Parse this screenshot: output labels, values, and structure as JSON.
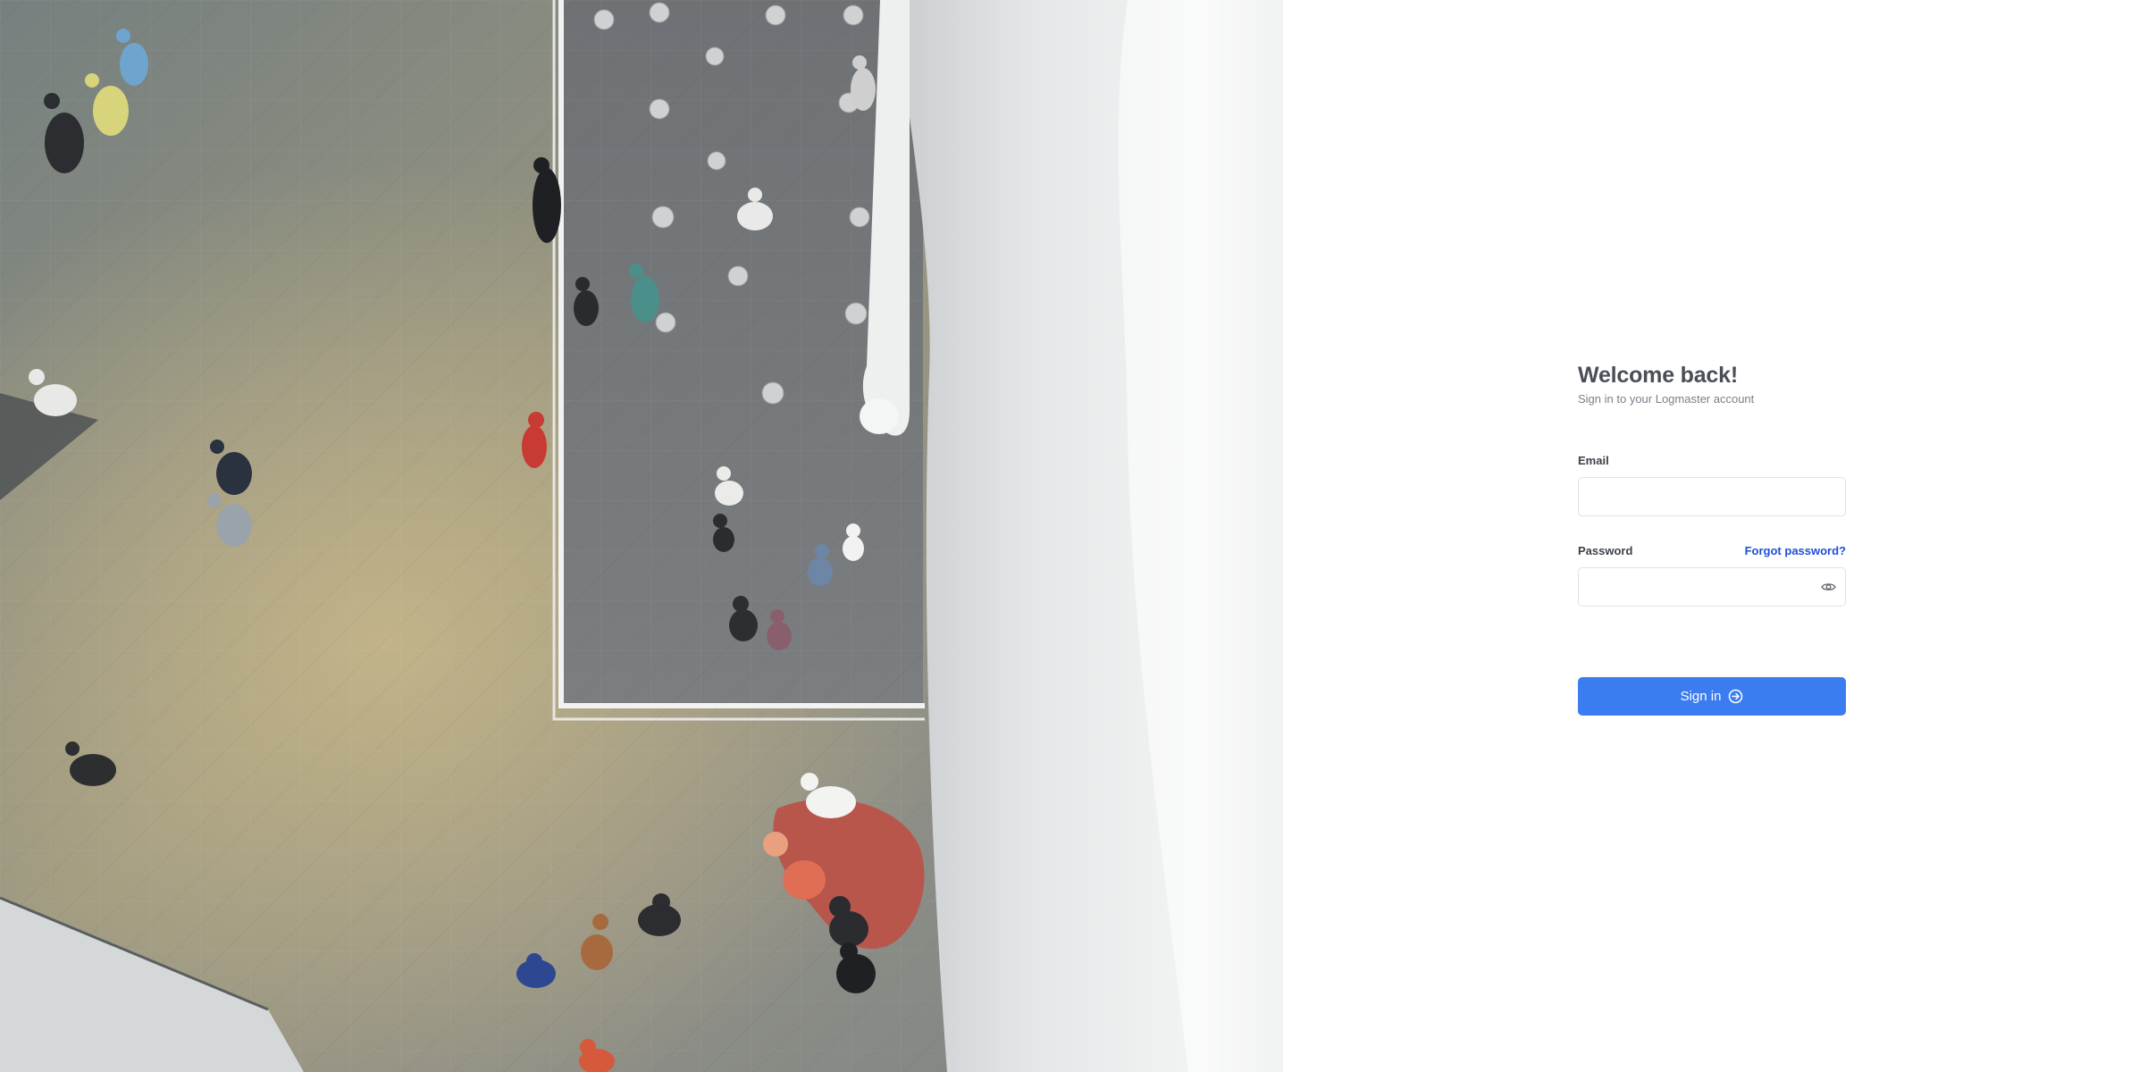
{
  "auth": {
    "title": "Welcome back!",
    "subtitle": "Sign in to your Logmaster account",
    "email": {
      "label": "Email",
      "value": "",
      "placeholder": ""
    },
    "password": {
      "label": "Password",
      "value": "",
      "placeholder": "",
      "forgot_label": "Forgot password?",
      "toggle_icon": "eye-icon"
    },
    "submit": {
      "label": "Sign in",
      "icon": "arrow-circle-right-icon"
    }
  },
  "colors": {
    "accent": "#3b7df0",
    "link": "#1f4fd6",
    "title": "#4a4f57",
    "subtitle": "#7a7f88"
  }
}
